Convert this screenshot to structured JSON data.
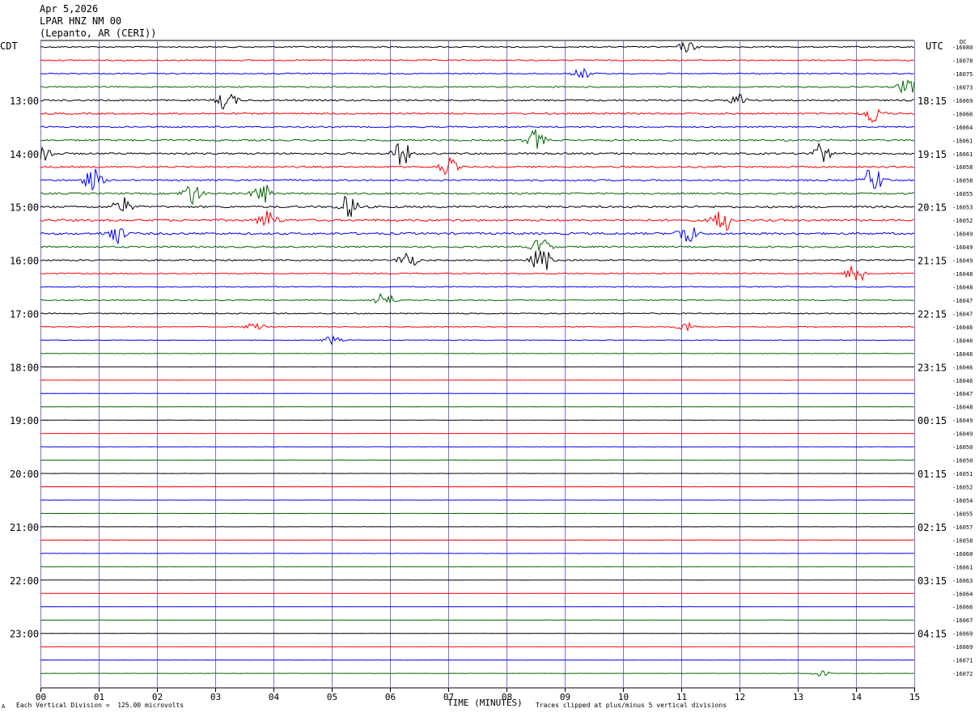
{
  "header": {
    "date": "Apr 5,2026",
    "station": "LPAR HNZ NM 00",
    "location": "(Lepanto, AR (CERI))"
  },
  "left_zone_label": "CDT",
  "right_zone_label": "UTC",
  "dc_label": "DC",
  "footer": {
    "division_note": "Each Vertical Division =  125.00 microvolts",
    "xlabel": "TIME (MINUTES)",
    "clip_note": "Traces clipped at plus/minus 5 vertical divisions",
    "corner_mark": "A"
  },
  "colors": {
    "trace_cycle": [
      "#000000",
      "#ff0000",
      "#0000ff",
      "#006600"
    ],
    "grid_vertical": "#7777cc",
    "frame": "#000000"
  },
  "chart_data": {
    "type": "line",
    "title": "LPAR HNZ NM 00",
    "xlabel": "TIME (MINUTES)",
    "xlim": [
      0,
      15
    ],
    "x_ticks": [
      "00",
      "01",
      "02",
      "03",
      "04",
      "05",
      "06",
      "07",
      "08",
      "09",
      "10",
      "11",
      "12",
      "13",
      "14",
      "15"
    ],
    "grid": true,
    "left_hour_labels": [
      {
        "row": 4,
        "label": "13:00"
      },
      {
        "row": 8,
        "label": "14:00"
      },
      {
        "row": 12,
        "label": "15:00"
      },
      {
        "row": 16,
        "label": "16:00"
      },
      {
        "row": 20,
        "label": "17:00"
      },
      {
        "row": 24,
        "label": "18:00"
      },
      {
        "row": 28,
        "label": "19:00"
      },
      {
        "row": 32,
        "label": "20:00"
      },
      {
        "row": 36,
        "label": "21:00"
      },
      {
        "row": 40,
        "label": "22:00"
      },
      {
        "row": 44,
        "label": "23:00"
      }
    ],
    "right_hour_labels": [
      {
        "row": 4,
        "label": "18:15"
      },
      {
        "row": 8,
        "label": "19:15"
      },
      {
        "row": 12,
        "label": "20:15"
      },
      {
        "row": 16,
        "label": "21:15"
      },
      {
        "row": 20,
        "label": "22:15"
      },
      {
        "row": 24,
        "label": "23:15"
      },
      {
        "row": 28,
        "label": "00:15"
      },
      {
        "row": 32,
        "label": "01:15"
      },
      {
        "row": 36,
        "label": "02:15"
      },
      {
        "row": 40,
        "label": "03:15"
      },
      {
        "row": 44,
        "label": "04:15"
      }
    ],
    "dc_offsets": [
      "-16080",
      "-16078",
      "-16075",
      "-16073",
      "-16069",
      "-16066",
      "-16064",
      "-16061",
      "-16061",
      "-16058",
      "-16058",
      "-16055",
      "-16053",
      "-16052",
      "-16049",
      "-16049",
      "-16049",
      "-16048",
      "-16048",
      "-16047",
      "-16047",
      "-16046",
      "-16046",
      "-16046",
      "-16046",
      "-16046",
      "-16047",
      "-16048",
      "-16049",
      "-16049",
      "-16050",
      "-16050",
      "-16051",
      "-16052",
      "-16054",
      "-16055",
      "-16057",
      "-16058",
      "-16060",
      "-16061",
      "-16063",
      "-16064",
      "-16066",
      "-16067",
      "-16069",
      "-16069",
      "-16071",
      "-16072"
    ],
    "row_activity": [
      0.35,
      0.35,
      0.3,
      0.35,
      0.45,
      0.45,
      0.4,
      0.45,
      0.5,
      0.45,
      0.45,
      0.45,
      0.55,
      0.6,
      0.6,
      0.45,
      0.4,
      0.3,
      0.3,
      0.3,
      0.3,
      0.22,
      0.18,
      0.12,
      0.06,
      0.06,
      0.06,
      0.06,
      0.06,
      0.06,
      0.06,
      0.06,
      0.05,
      0.05,
      0.05,
      0.05,
      0.05,
      0.05,
      0.05,
      0.05,
      0.05,
      0.05,
      0.05,
      0.05,
      0.05,
      0.05,
      0.05,
      0.05
    ],
    "bursts": [
      {
        "row": 0,
        "minute": 11.1,
        "amp": 1.0
      },
      {
        "row": 2,
        "minute": 9.3,
        "amp": 1.0
      },
      {
        "row": 3,
        "minute": 14.9,
        "amp": 2.0
      },
      {
        "row": 4,
        "minute": 3.2,
        "amp": 2.0
      },
      {
        "row": 4,
        "minute": 12.0,
        "amp": 1.2
      },
      {
        "row": 5,
        "minute": 14.3,
        "amp": 2.0
      },
      {
        "row": 7,
        "minute": 8.5,
        "amp": 2.0
      },
      {
        "row": 8,
        "minute": 0.05,
        "amp": 2.0
      },
      {
        "row": 8,
        "minute": 6.2,
        "amp": 2.5
      },
      {
        "row": 8,
        "minute": 13.4,
        "amp": 2.0
      },
      {
        "row": 9,
        "minute": 7.0,
        "amp": 1.8
      },
      {
        "row": 10,
        "minute": 0.9,
        "amp": 2.2
      },
      {
        "row": 10,
        "minute": 14.3,
        "amp": 3.0
      },
      {
        "row": 11,
        "minute": 2.6,
        "amp": 2.6
      },
      {
        "row": 11,
        "minute": 3.8,
        "amp": 2.2
      },
      {
        "row": 12,
        "minute": 1.4,
        "amp": 1.8
      },
      {
        "row": 12,
        "minute": 5.3,
        "amp": 2.5
      },
      {
        "row": 13,
        "minute": 3.9,
        "amp": 2.0
      },
      {
        "row": 13,
        "minute": 11.7,
        "amp": 2.8
      },
      {
        "row": 14,
        "minute": 1.3,
        "amp": 1.8
      },
      {
        "row": 14,
        "minute": 11.1,
        "amp": 2.2
      },
      {
        "row": 15,
        "minute": 8.6,
        "amp": 1.8
      },
      {
        "row": 16,
        "minute": 6.3,
        "amp": 1.8
      },
      {
        "row": 16,
        "minute": 8.6,
        "amp": 3.0
      },
      {
        "row": 17,
        "minute": 14.0,
        "amp": 2.5
      },
      {
        "row": 19,
        "minute": 5.9,
        "amp": 1.8
      },
      {
        "row": 21,
        "minute": 3.7,
        "amp": 1.2
      },
      {
        "row": 21,
        "minute": 11.1,
        "amp": 1.0
      },
      {
        "row": 22,
        "minute": 5.0,
        "amp": 0.8
      },
      {
        "row": 47,
        "minute": 13.4,
        "amp": 0.6
      }
    ]
  }
}
